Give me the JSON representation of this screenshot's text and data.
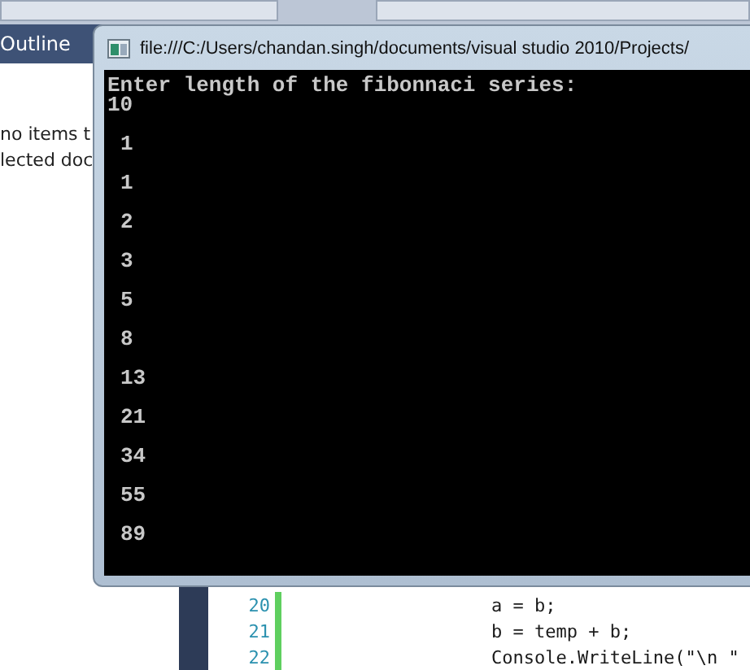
{
  "outline_panel": {
    "title": "Outline",
    "message_lines": [
      "no items t",
      "lected doc"
    ]
  },
  "editor": {
    "lines": [
      {
        "number": "20",
        "code": "a = b;"
      },
      {
        "number": "21",
        "code": "b = temp + b;"
      },
      {
        "number": "22",
        "code": "Console.WriteLine(\"\\n \""
      }
    ]
  },
  "console_window": {
    "title": "file:///C:/Users/chandan.singh/documents/visual studio 2010/Projects/",
    "prompt": "Enter length of the fibonnaci series:",
    "input": "10",
    "results": [
      "1",
      "1",
      "2",
      "3",
      "5",
      "8",
      "13",
      "21",
      "34",
      "55",
      "89"
    ]
  }
}
